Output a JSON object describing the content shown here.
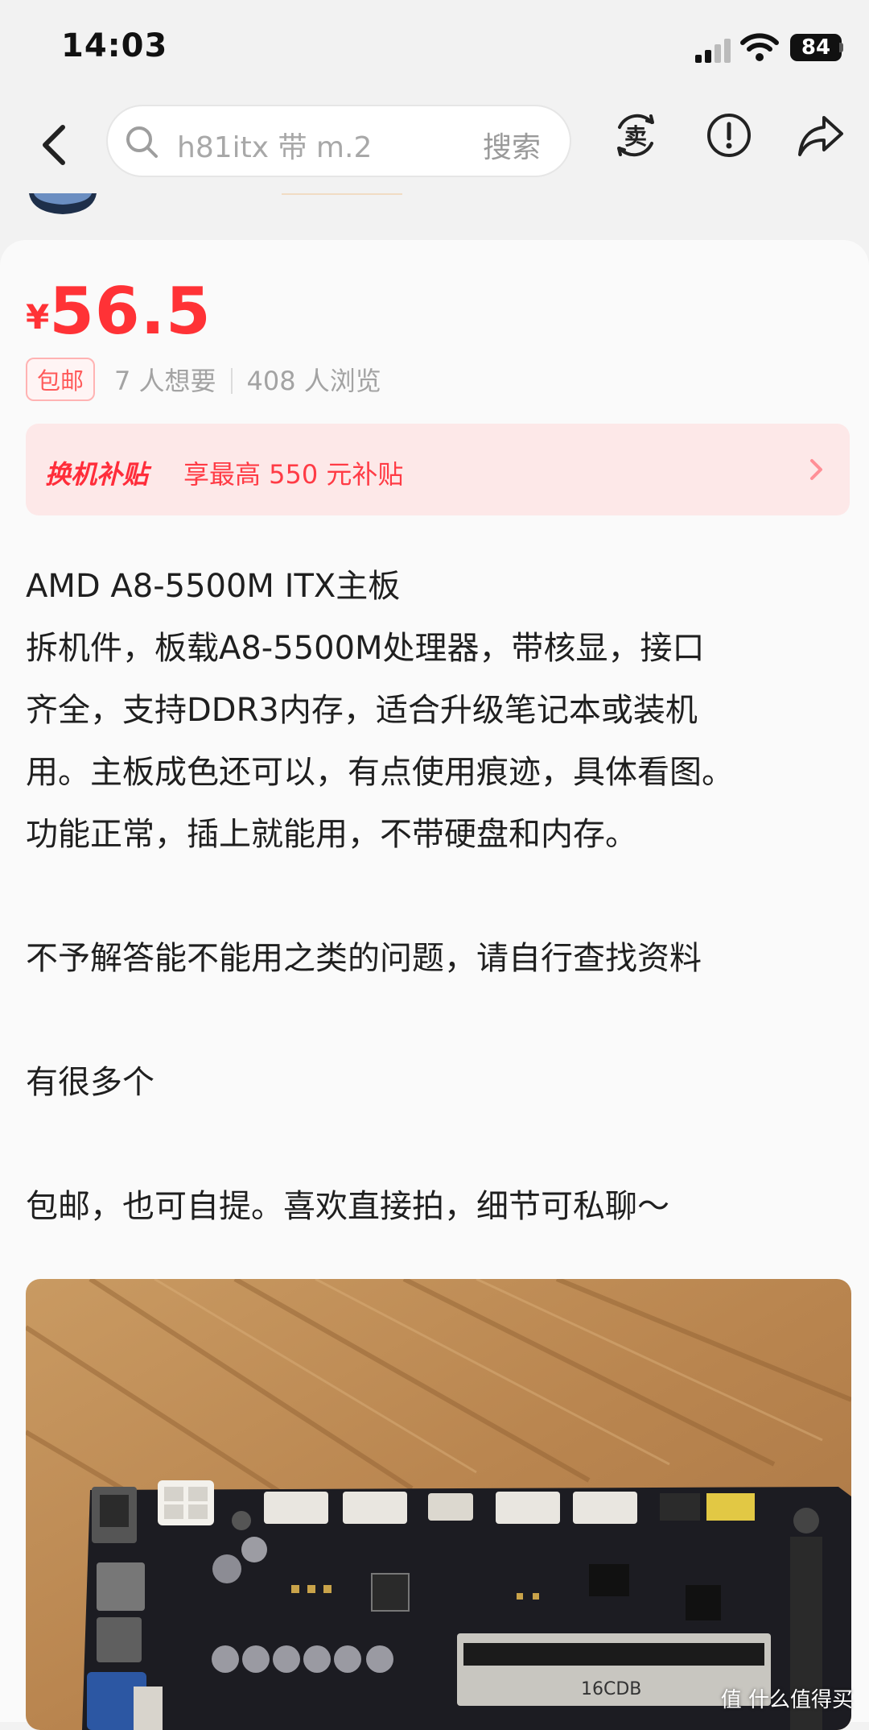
{
  "status_bar": {
    "time": "14:03",
    "battery": "84"
  },
  "nav": {
    "search_query": "h81itx 带 m.2",
    "search_button": "搜索",
    "icons": [
      "back-icon",
      "sell-icon",
      "report-icon",
      "share-icon"
    ]
  },
  "product": {
    "currency": "¥",
    "price": "56.5",
    "free_shipping": "包邮",
    "wants": "7 人想要",
    "views": "408 人浏览"
  },
  "subsidy": {
    "title": "换机补贴",
    "text": "享最高 550 元补贴"
  },
  "description": {
    "line1": "AMD A8-5500M ITX主板",
    "line2": "拆机件，板载A8-5500M处理器，带核显，接口",
    "line3": "齐全，支持DDR3内存，适合升级笔记本或装机",
    "line4": "用。主板成色还可以，有点使用痕迹，具体看图。",
    "line5": "功能正常，插上就能用，不带硬盘和内存。",
    "line6": "不予解答能不能用之类的问题，请自行查找资料",
    "line7": "有很多个",
    "line8": "包邮，也可自提。喜欢直接拍，细节可私聊～"
  },
  "photo": {
    "board_label": "16CDB"
  },
  "watermark": "值 什么值得买",
  "colors": {
    "price_red": "#ff3236",
    "subsidy_bg": "#fde8e8",
    "page_bg": "#f2f2f2"
  }
}
